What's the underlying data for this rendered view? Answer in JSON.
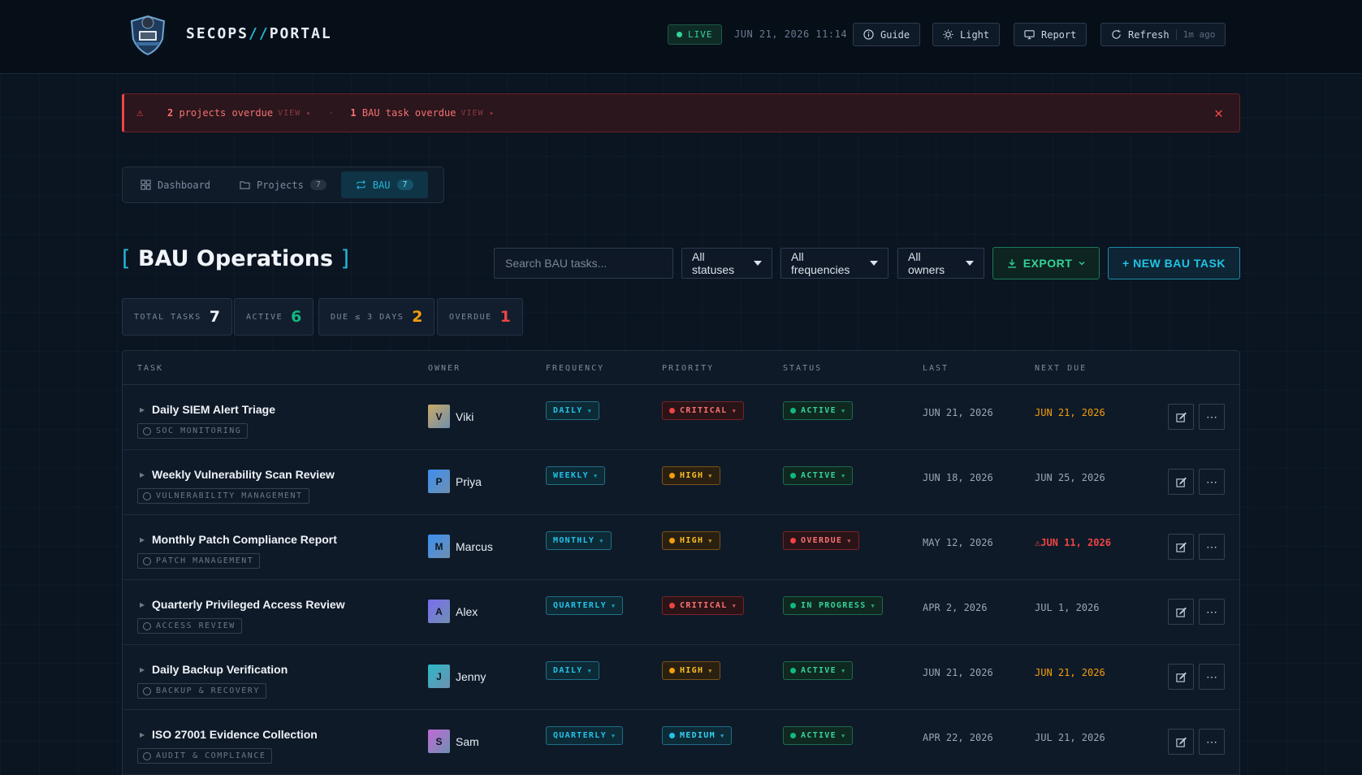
{
  "header": {
    "brand_left": "SECOPS",
    "brand_sep": "//",
    "brand_right": "PORTAL",
    "live": "LIVE",
    "datetime": "JUN 21, 2026 11:14",
    "guide": "Guide",
    "light": "Light",
    "report": "Report",
    "refresh": "Refresh",
    "refresh_ago": "1m ago"
  },
  "alert": {
    "projects_count": "2",
    "projects_text": "projects overdue",
    "bau_count": "1",
    "bau_text": "BAU task overdue",
    "view": "VIEW ▸",
    "sep": "·",
    "close": "✕",
    "warn": "⚠"
  },
  "tabs": [
    {
      "label": "Dashboard",
      "icon": "grid-icon"
    },
    {
      "label": "Projects",
      "count": "7",
      "icon": "folder-icon"
    },
    {
      "label": "BAU",
      "count": "7",
      "icon": "repeat-icon",
      "active": true
    }
  ],
  "page": {
    "bracket_open": "[",
    "title": "BAU Operations",
    "bracket_close": "]"
  },
  "toolbar": {
    "search_placeholder": "Search BAU tasks...",
    "status_filter": "All statuses",
    "frequency_filter": "All frequencies",
    "owner_filter": "All owners",
    "export": "EXPORT",
    "new_task": "+ NEW BAU TASK"
  },
  "stats": [
    {
      "label": "TOTAL TASKS",
      "value": "7",
      "color": "#f1f5f9"
    },
    {
      "label": "ACTIVE",
      "value": "6",
      "color": "#10b981"
    },
    {
      "label": "DUE ≤ 3 DAYS",
      "value": "2",
      "color": "#f59e0b"
    },
    {
      "label": "OVERDUE",
      "value": "1",
      "color": "#ef4444"
    }
  ],
  "table": {
    "columns": [
      "TASK",
      "OWNER",
      "FREQUENCY",
      "PRIORITY",
      "STATUS",
      "LAST",
      "NEXT DUE"
    ],
    "rows": [
      {
        "task": "Daily SIEM Alert Triage",
        "category": "SOC MONITORING",
        "owner": "Viki",
        "initial": "V",
        "avatar_color": "#c9a862",
        "frequency": "DAILY",
        "priority": "CRITICAL",
        "status": "ACTIVE",
        "last": "JUN 21, 2026",
        "next": "JUN 21, 2026",
        "next_state": "soon"
      },
      {
        "task": "Weekly Vulnerability Scan Review",
        "category": "VULNERABILITY MANAGEMENT",
        "owner": "Priya",
        "initial": "P",
        "avatar_color": "#3b8ff0",
        "frequency": "WEEKLY",
        "priority": "HIGH",
        "status": "ACTIVE",
        "last": "JUN 18, 2026",
        "next": "JUN 25, 2026",
        "next_state": "normal"
      },
      {
        "task": "Monthly Patch Compliance Report",
        "category": "PATCH MANAGEMENT",
        "owner": "Marcus",
        "initial": "M",
        "avatar_color": "#3b8ff0",
        "frequency": "MONTHLY",
        "priority": "HIGH",
        "status": "OVERDUE",
        "last": "MAY 12, 2026",
        "next": "JUN 11, 2026",
        "next_state": "late"
      },
      {
        "task": "Quarterly Privileged Access Review",
        "category": "ACCESS REVIEW",
        "owner": "Alex",
        "initial": "A",
        "avatar_color": "#7b6cf0",
        "frequency": "QUARTERLY",
        "priority": "CRITICAL",
        "status": "IN PROGRESS",
        "last": "APR 2, 2026",
        "next": "JUL 1, 2026",
        "next_state": "normal"
      },
      {
        "task": "Daily Backup Verification",
        "category": "BACKUP & RECOVERY",
        "owner": "Jenny",
        "initial": "J",
        "avatar_color": "#2ab8c8",
        "frequency": "DAILY",
        "priority": "HIGH",
        "status": "ACTIVE",
        "last": "JUN 21, 2026",
        "next": "JUN 21, 2026",
        "next_state": "soon"
      },
      {
        "task": "ISO 27001 Evidence Collection",
        "category": "AUDIT & COMPLIANCE",
        "owner": "Sam",
        "initial": "S",
        "avatar_color": "#c06ad8",
        "frequency": "QUARTERLY",
        "priority": "MEDIUM",
        "status": "ACTIVE",
        "last": "APR 22, 2026",
        "next": "JUL 21, 2026",
        "next_state": "normal"
      }
    ]
  }
}
